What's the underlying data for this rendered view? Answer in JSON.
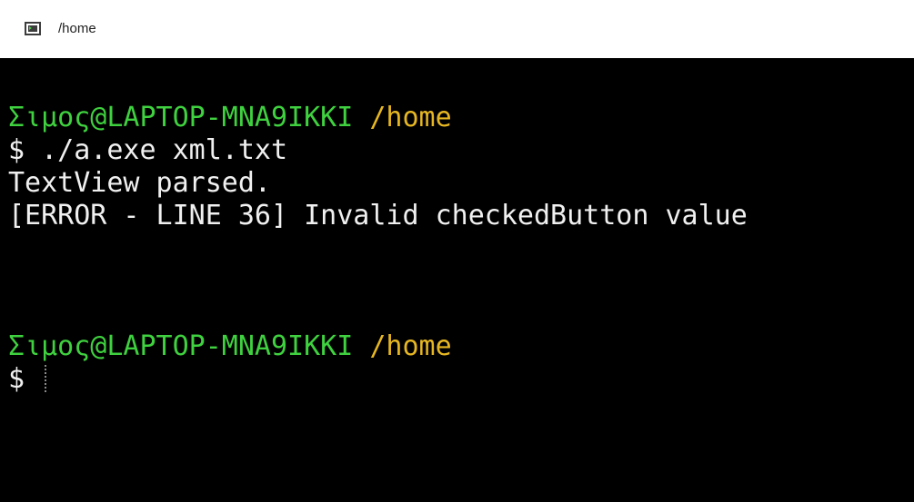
{
  "window": {
    "title": "/home",
    "icon": "terminal-icon"
  },
  "colors": {
    "terminal_bg": "#000000",
    "text": "#f0f0f0",
    "prompt_user": "#3fd13f",
    "prompt_path": "#e7b722"
  },
  "terminal": {
    "prompt_1": {
      "user_host": "Σιμος@LAPTOP-MNA9IKKI",
      "path": "/home",
      "symbol": "$",
      "command": "./a.exe xml.txt"
    },
    "output": [
      "TextView parsed.",
      "[ERROR - LINE 36] Invalid checkedButton value"
    ],
    "prompt_2": {
      "user_host": "Σιμος@LAPTOP-MNA9IKKI",
      "path": "/home",
      "symbol": "$",
      "command": ""
    }
  }
}
